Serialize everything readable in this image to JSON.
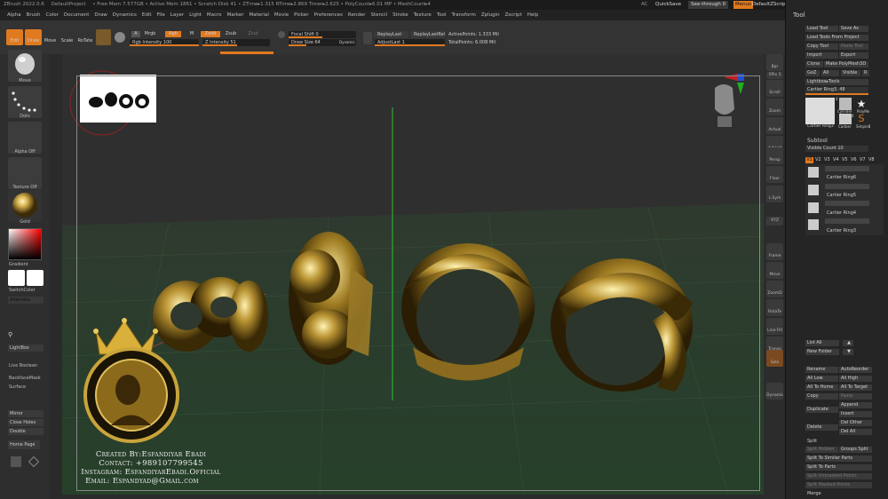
{
  "titlebar": {
    "app": "ZBrush 2022.0.6",
    "project": "DefaultProject",
    "stats": "• Free Mem 7.577GB • Active Mem 1861 • Scratch Disk 41 • ZTime▸1.315 RTime▸2.869 Timer▸2.625 • PolyCount▸6.01 MP • MeshCount▸4",
    "ac": "AC",
    "quicksave": "QuickSave",
    "see_through": "See-through  0",
    "menus": "Menus",
    "default_zscript": "DefaultZScript"
  },
  "menu": [
    "Alpha",
    "Brush",
    "Color",
    "Document",
    "Draw",
    "Dynamics",
    "Edit",
    "File",
    "Layer",
    "Light",
    "Macro",
    "Marker",
    "Material",
    "Movie",
    "Picker",
    "Preferences",
    "Render",
    "Stencil",
    "Stroke",
    "Texture",
    "Tool",
    "Transform",
    "Zplugin",
    "Zscript",
    "Help"
  ],
  "toolbar": {
    "edit": "Edit",
    "draw": "Draw",
    "move": "Move",
    "scale": "Scale",
    "rotate": "RoTate",
    "a_label": "A",
    "mrgb": "Mrgb",
    "rgb": "Rgb",
    "m": "M",
    "rgb_intensity": "Rgb Intensity 100",
    "zadd": "Zadd",
    "zsub": "Zsub",
    "zcut": "Zcut",
    "z_intensity": "Z Intensity 51",
    "focal_shift": "Focal Shift 0",
    "draw_size": "Draw Size 64",
    "dynamic": "Dynamic",
    "replay_last": "ReplayLast",
    "replay_last_rel": "ReplayLastRel",
    "adjust_last": "AdjustLast 1",
    "active_points": "ActivePoints: 1.333 Mil",
    "total_points": "TotalPoints: 6.008 Mil"
  },
  "left_shelf": {
    "brush": "Move",
    "stroke": "Dots",
    "alpha": "Alpha Off",
    "texture": "Texture Off",
    "material": "Gold",
    "gradient": "Gradient",
    "switch_color": "SwitchColor",
    "alternate": "Alternate",
    "lightbox": "LightBox",
    "live_boolean": "Live Boolean",
    "backface_mask": "BackfaceMask",
    "surface": "Surface",
    "mirror": "Mirror",
    "close_holes": "Close Holes",
    "double": "Double",
    "home_page": "Home Page"
  },
  "right_shelf": [
    "Bpr",
    "SPix 3",
    "Scroll",
    "Zoom",
    "Actual",
    "AAHalf",
    "Persp",
    "Floor",
    "L.Sym",
    "Frame",
    "Move",
    "ZoomD",
    "RotaTe",
    "Line Fill",
    "Transp",
    "Solo",
    "Dynamic"
  ],
  "tool_panel": {
    "title": "Tool",
    "load_tool": "Load Tool",
    "save_as": "Save As",
    "load_tools_from_project": "Load Tools From Project",
    "copy_tool": "Copy Tool",
    "paste_tool": "Paste Tool",
    "import": "Import",
    "export": "Export",
    "clone": "Clone",
    "make_polymesh": "Make PolyMesh3D",
    "goz": "GoZ",
    "all": "All",
    "visible": "Visible",
    "r": "R",
    "lightbox_tools": "Lightbox▸Tools",
    "current_tool": "Cartier Ring3. 48",
    "tool_thumbs": [
      "Cartier Ring3",
      "Cylinder",
      "PolyMe",
      "Carbier",
      "SimpleB"
    ],
    "thumb_counts": [
      "4",
      "4"
    ],
    "subtool_header": "Subtool",
    "visible_count": "Visible Count 10",
    "versions": [
      "V1",
      "V2",
      "V3",
      "V4",
      "V5",
      "V6",
      "V7",
      "V8"
    ],
    "subtools": [
      "Cartier Ring6",
      "Cartier Ring5",
      "Cartier Ring4",
      "Cartier Ring3"
    ],
    "list_all": "List All",
    "new_folder": "New Folder",
    "rename": "Rename",
    "auto_reorder": "AutoReorder",
    "all_low": "All Low",
    "all_high": "All High",
    "all_to_home": "All To Home",
    "all_to_target": "All To Target",
    "copy": "Copy",
    "paste": "Paste",
    "duplicate": "Duplicate",
    "append": "Append",
    "insert": "Insert",
    "delete": "Delete",
    "del_other": "Del Other",
    "del_all": "Del All",
    "split": "Split",
    "split_hidden": "Split Hidden",
    "groups_split": "Groups Split",
    "split_to_similar": "Split To Similar Parts",
    "split_to_parts": "Split To Parts",
    "split_unmasked": "Split Unmasked Points",
    "split_masked": "Split Masked Points",
    "merge": "Merge"
  },
  "credits": {
    "line1": "Created By:Esfandiyar Ebadi",
    "line2": "Contact: +989107799545",
    "line3": "Instagram: EsfandiyarEbadi.Official",
    "line4": "Email: Espandyad@Gmail.com"
  },
  "colors": {
    "accent": "#e07a1f",
    "gold": "#c9a43a",
    "background": "#2b2b2b"
  }
}
